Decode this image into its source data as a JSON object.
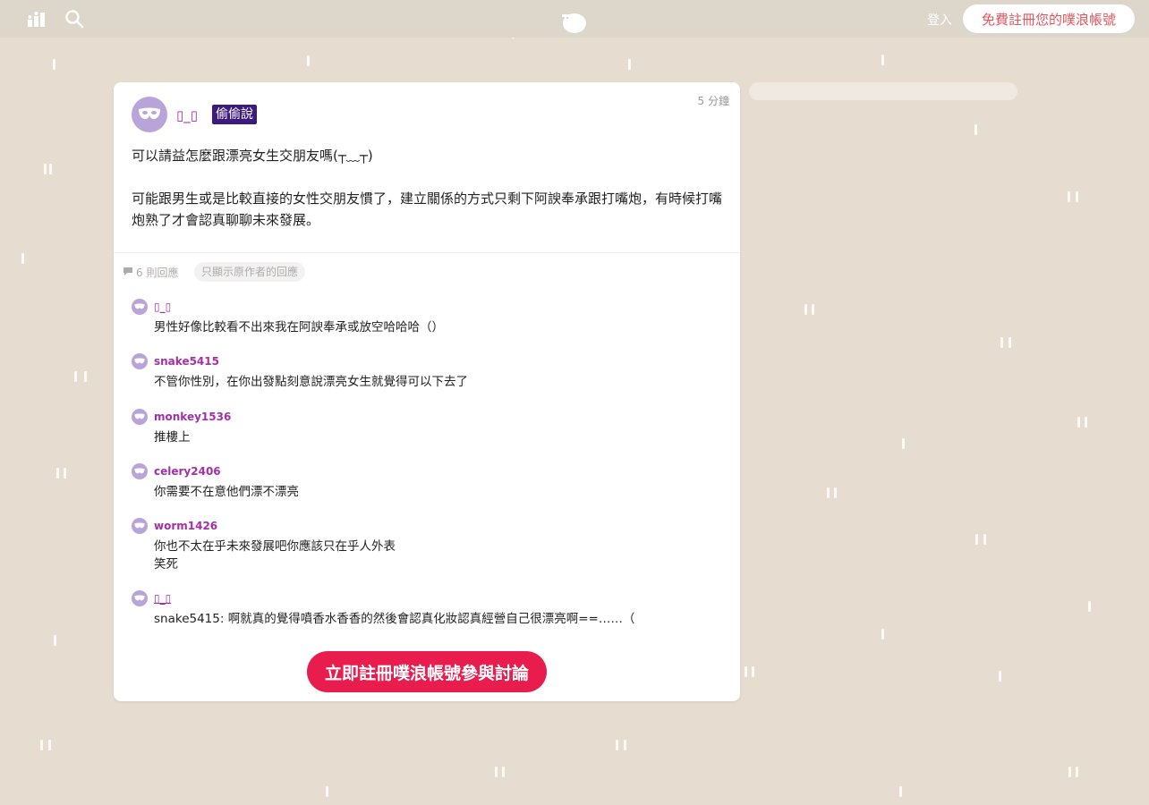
{
  "header": {
    "login_label": "登入",
    "signup_label": "免費註冊您的噗浪帳號",
    "icons": [
      "top-plurks-icon",
      "search-icon",
      "plurk-logo"
    ]
  },
  "post": {
    "author": "▯_▯",
    "tag": "偷偷說",
    "time": "5 分鐘",
    "content": [
      "可以請益怎麼跟漂亮女生交朋友嗎(┬﹏┬)",
      "可能跟男生或是比較直接的女性交朋友慣了，建立關係的方式只剩下阿諛奉承跟打嘴炮，有時候打嘴炮熟了才會認真聊聊未來發展。"
    ],
    "response_count": "6 則回應",
    "only_author_label": "只顯示原作者的回應"
  },
  "responses": [
    {
      "name": "▯_▯",
      "lines": [
        "男性好像比較看不出來我在阿諛奉承或放空哈哈哈（）"
      ]
    },
    {
      "name": "snake5415",
      "lines": [
        "不管你性別，在你出發點刻意說漂亮女生就覺得可以下去了"
      ]
    },
    {
      "name": "monkey1536",
      "lines": [
        "推樓上"
      ]
    },
    {
      "name": "celery2406",
      "lines": [
        "你需要不在意他們漂不漂亮"
      ]
    },
    {
      "name": "worm1426",
      "lines": [
        "你也不太在乎未來發展吧你應該只在乎人外表",
        "笑死"
      ]
    },
    {
      "name": "▯_▯",
      "lines": [
        "snake5415: 啊就真的覺得噴香水香香的然後會認真化妝認真經營自己很漂亮啊==……（"
      ]
    }
  ],
  "cta_label": "立即註冊噗浪帳號參與討論",
  "colors": {
    "background": "#e6ddd0",
    "accent": "#e81d4e",
    "username": "#a42fa8",
    "tag_bg": "#3d1a80",
    "avatar": "#b9a4da"
  }
}
